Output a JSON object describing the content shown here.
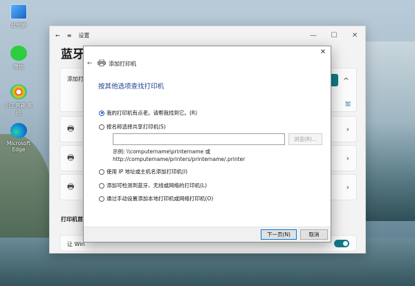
{
  "desktop": {
    "icons": [
      {
        "label": "此电脑",
        "icon": "computer-icon"
      },
      {
        "label": "微信",
        "icon": "wechat-icon"
      },
      {
        "label": "小工具箱 系统",
        "icon": "mini-tools-icon"
      },
      {
        "label": "Microsoft Edge",
        "icon": "edge-icon"
      }
    ]
  },
  "settings": {
    "title": "设置",
    "heading": "蓝牙",
    "add_label": "添加打",
    "add_link": "加",
    "section_title": "打印机首",
    "last_row_label": "让 Win",
    "icons": {
      "back": "←",
      "menu": "≡",
      "minimize": "—",
      "maximize": "☐",
      "close": "✕",
      "chevron": "›",
      "printer": "🖶"
    }
  },
  "dialog": {
    "title": "添加打印机",
    "heading": "按其他选项查找打印机",
    "options": [
      {
        "label": "我的打印机有点老。请帮我找到它。(R)",
        "checked": true
      },
      {
        "label": "按名称选择共享打印机(S)",
        "checked": false
      },
      {
        "label": "使用 IP 地址或主机名添加打印机(I)",
        "checked": false
      },
      {
        "label": "添加可检测到蓝牙、无线或网络的打印机(L)",
        "checked": false
      },
      {
        "label": "通过手动设置添加本地打印机或网络打印机(O)",
        "checked": false
      }
    ],
    "share_input_value": "",
    "browse_label": "浏览(R)...",
    "example_line1": "示例: \\\\computername\\printername 或",
    "example_line2": "http://computername/printers/printername/.printer",
    "next_label": "下一页(N)",
    "cancel_label": "取消",
    "close_glyph": "✕",
    "back_glyph": "←"
  }
}
